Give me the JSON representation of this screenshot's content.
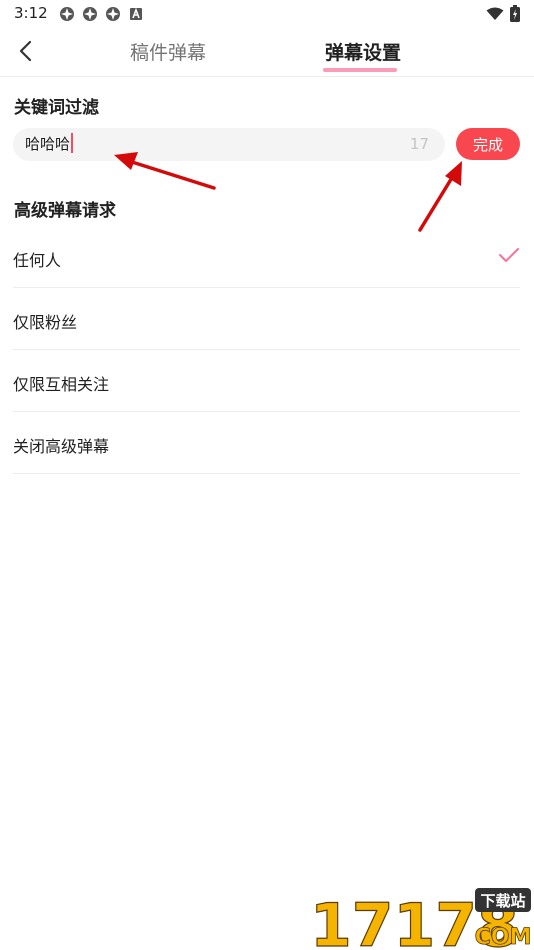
{
  "status_bar": {
    "time": "3:12",
    "icons": [
      "notification-icon",
      "notification-icon",
      "notification-icon",
      "app-a-icon",
      "wifi-icon",
      "battery-charging-icon"
    ]
  },
  "header": {
    "tabs": [
      {
        "label": "稿件弹幕",
        "active": false
      },
      {
        "label": "弹幕设置",
        "active": true
      }
    ],
    "accent_color": "#fb7299"
  },
  "keyword_filter": {
    "title": "关键词过滤",
    "input_value": "哈哈哈",
    "char_count": "17",
    "done_label": "完成",
    "done_color": "#f9474f"
  },
  "advanced_danmaku": {
    "title": "高级弹幕请求",
    "options": [
      {
        "label": "任何人",
        "selected": true
      },
      {
        "label": "仅限粉丝",
        "selected": false
      },
      {
        "label": "仅限互相关注",
        "selected": false
      },
      {
        "label": "关闭高级弹幕",
        "selected": false
      }
    ],
    "check_color": "#fb7299"
  },
  "watermark": {
    "main": "17178",
    "badge": "下载站",
    "domain": "COM"
  }
}
